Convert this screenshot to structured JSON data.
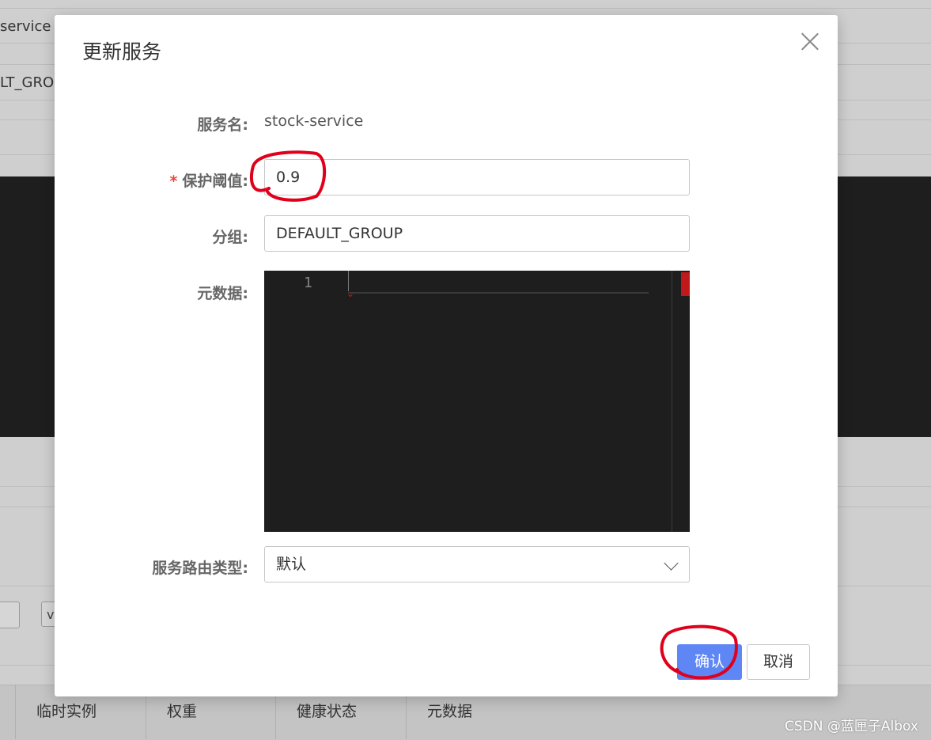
{
  "background": {
    "row1_text": "service",
    "row2_text": "LT_GRO",
    "box_text": "v",
    "table_headers": [
      "临时实例",
      "权重",
      "健康状态",
      "元数据"
    ],
    "watermark": "CSDN @蓝匣子Albox"
  },
  "dialog": {
    "title": "更新服务",
    "service_name_label": "服务名:",
    "service_name_value": "stock-service",
    "required_mark": "*",
    "threshold_label": "保护阈值:",
    "threshold_value": "0.9",
    "group_label": "分组:",
    "group_value": "DEFAULT_GROUP",
    "metadata_label": "元数据:",
    "editor_line_number": "1",
    "route_label": "服务路由类型:",
    "route_value": "默认",
    "confirm_label": "确认",
    "cancel_label": "取消"
  },
  "colors": {
    "primary": "#5f86f5",
    "required": "#f04134",
    "annotation": "#e0001b",
    "editor_bg": "#1e1e1e"
  }
}
